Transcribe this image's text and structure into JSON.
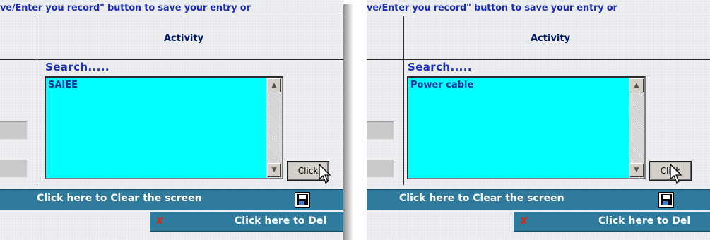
{
  "instruction_text": "ve/Enter you record\" button to save your entry or",
  "activity_header": "Activity",
  "search_label": "Search.....",
  "clear_button_label": "Click here to Clear the screen",
  "delete_button_label": "Click here to Del",
  "click_button_label": "Click",
  "panels": [
    {
      "list_value": "SAIEE"
    },
    {
      "list_value": "Power cable"
    }
  ],
  "icons": {
    "save": "floppy-disk-icon",
    "delete": "delete-tool-icon",
    "scroll_up": "arrow-up-icon",
    "scroll_down": "arrow-down-icon",
    "cursor": "pointer-cursor-icon"
  },
  "colors": {
    "listbox": "#00ffff",
    "bar": "#2e7b9e",
    "label": "#1a2fb5"
  }
}
